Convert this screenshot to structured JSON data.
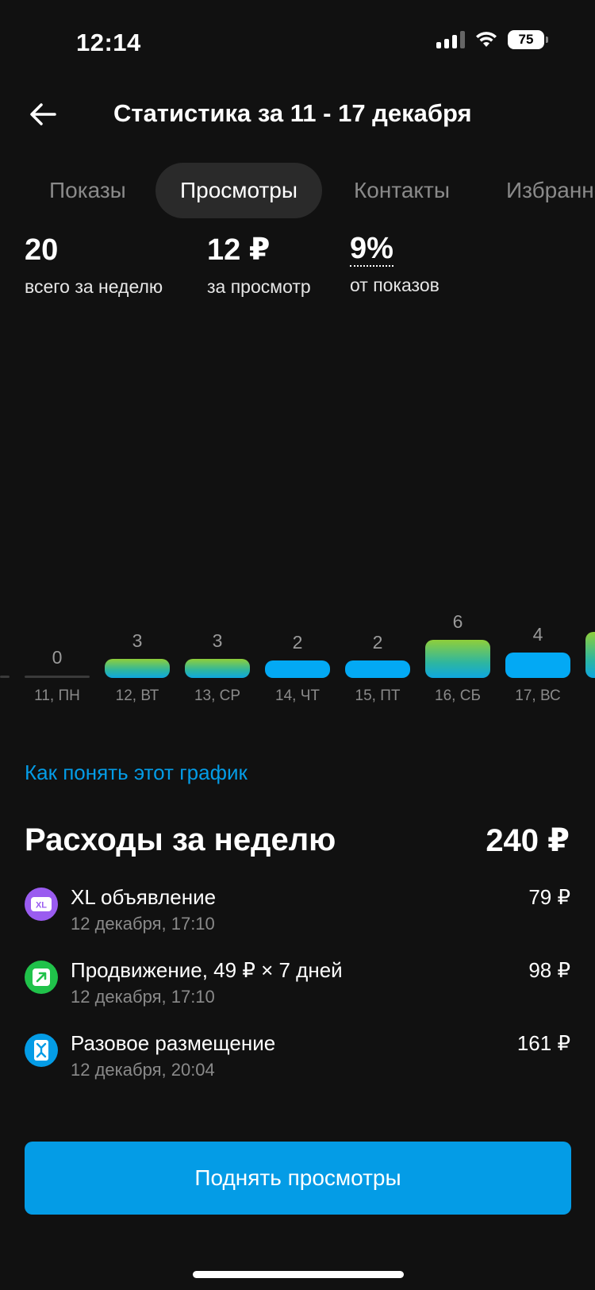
{
  "status_bar": {
    "time": "12:14",
    "battery": "75"
  },
  "header": {
    "title": "Статистика за 11 - 17 декабря"
  },
  "tabs": [
    {
      "label": "Показы",
      "active": false
    },
    {
      "label": "Просмотры",
      "active": true
    },
    {
      "label": "Контакты",
      "active": false
    },
    {
      "label": "Избранное",
      "active": false
    }
  ],
  "stats": [
    {
      "value": "20",
      "label": "всего за неделю"
    },
    {
      "value": "12 ₽",
      "label": "за просмотр"
    },
    {
      "value": "9%",
      "label": "от показов"
    }
  ],
  "chart_data": {
    "type": "bar",
    "categories": [
      "11, ПН",
      "12, ВТ",
      "13, СР",
      "14, ЧТ",
      "15, ПТ",
      "16, СБ",
      "17, ВС"
    ],
    "values": [
      0,
      3,
      3,
      2,
      2,
      6,
      4
    ],
    "bar_styles": [
      "zero",
      "green",
      "green",
      "blue",
      "blue",
      "green",
      "blue"
    ],
    "colors": {
      "green_top": "#8fcf3a",
      "green_bottom": "#0ea7e0",
      "blue": "#03a9f4"
    }
  },
  "help_link": "Как понять этот график",
  "expenses": {
    "title": "Расходы за неделю",
    "total": "240 ₽",
    "items": [
      {
        "name": "XL объявление",
        "date": "12 декабря, 17:10",
        "price": "79 ₽",
        "icon": "xl-icon",
        "color": "#9a5cf0"
      },
      {
        "name": "Продвижение, 49 ₽ × 7 дней",
        "date": "12 декабря, 17:10",
        "price": "98 ₽",
        "icon": "promotion-arrow-icon",
        "color": "#20c24a"
      },
      {
        "name": "Разовое размещение",
        "date": "12 декабря, 20:04",
        "price": "161 ₽",
        "icon": "placement-icon",
        "color": "#049ce6"
      }
    ]
  },
  "cta": {
    "label": "Поднять просмотры"
  }
}
